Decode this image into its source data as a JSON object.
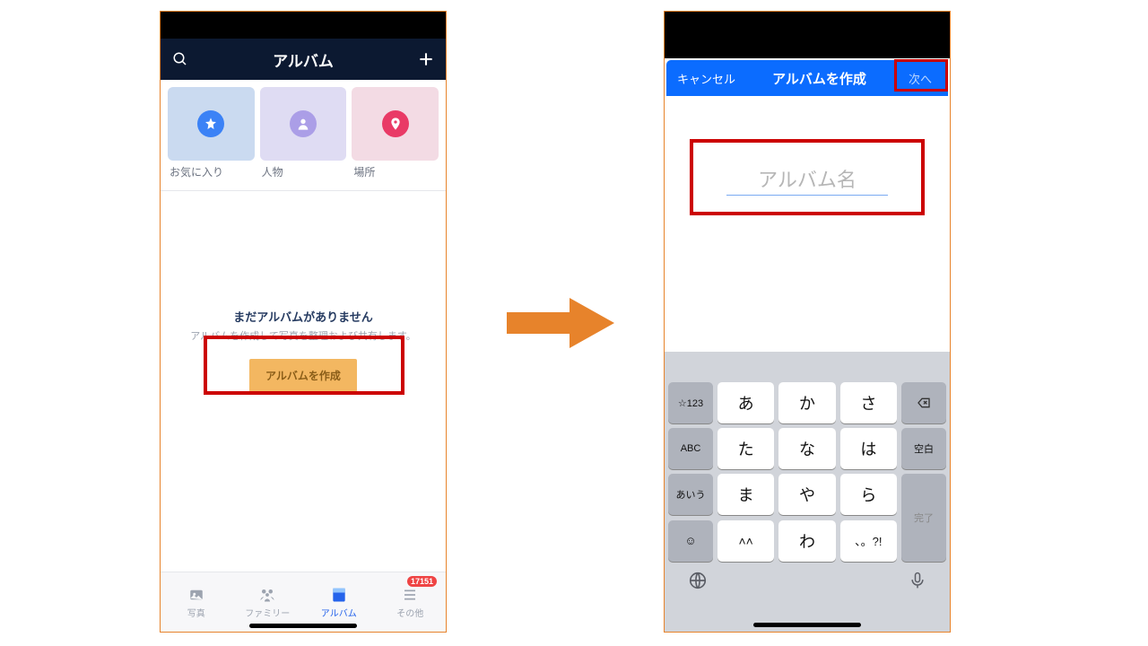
{
  "left": {
    "header": {
      "title": "アルバム"
    },
    "tiles": [
      {
        "label": "お気に入り"
      },
      {
        "label": "人物"
      },
      {
        "label": "場所"
      }
    ],
    "empty": {
      "title": "まだアルバムがありません",
      "subtitle": "アルバムを作成して写真を整理および共有します。",
      "button": "アルバムを作成"
    },
    "tabs": [
      {
        "label": "写真"
      },
      {
        "label": "ファミリー"
      },
      {
        "label": "アルバム"
      },
      {
        "label": "その他",
        "badge": "17151"
      }
    ]
  },
  "right": {
    "nav": {
      "cancel": "キャンセル",
      "title": "アルバムを作成",
      "next": "次へ"
    },
    "input": {
      "placeholder": "アルバム名"
    },
    "keyboard": {
      "side_left": [
        "☆123",
        "ABC",
        "あいう"
      ],
      "main_rows": [
        [
          "あ",
          "か",
          "さ"
        ],
        [
          "た",
          "な",
          "は"
        ],
        [
          "ま",
          "や",
          "ら"
        ],
        [
          "˄˄",
          "わ",
          "、。?!"
        ]
      ],
      "side_right_top": "空白",
      "done": "完了",
      "emoji": "☺"
    }
  }
}
